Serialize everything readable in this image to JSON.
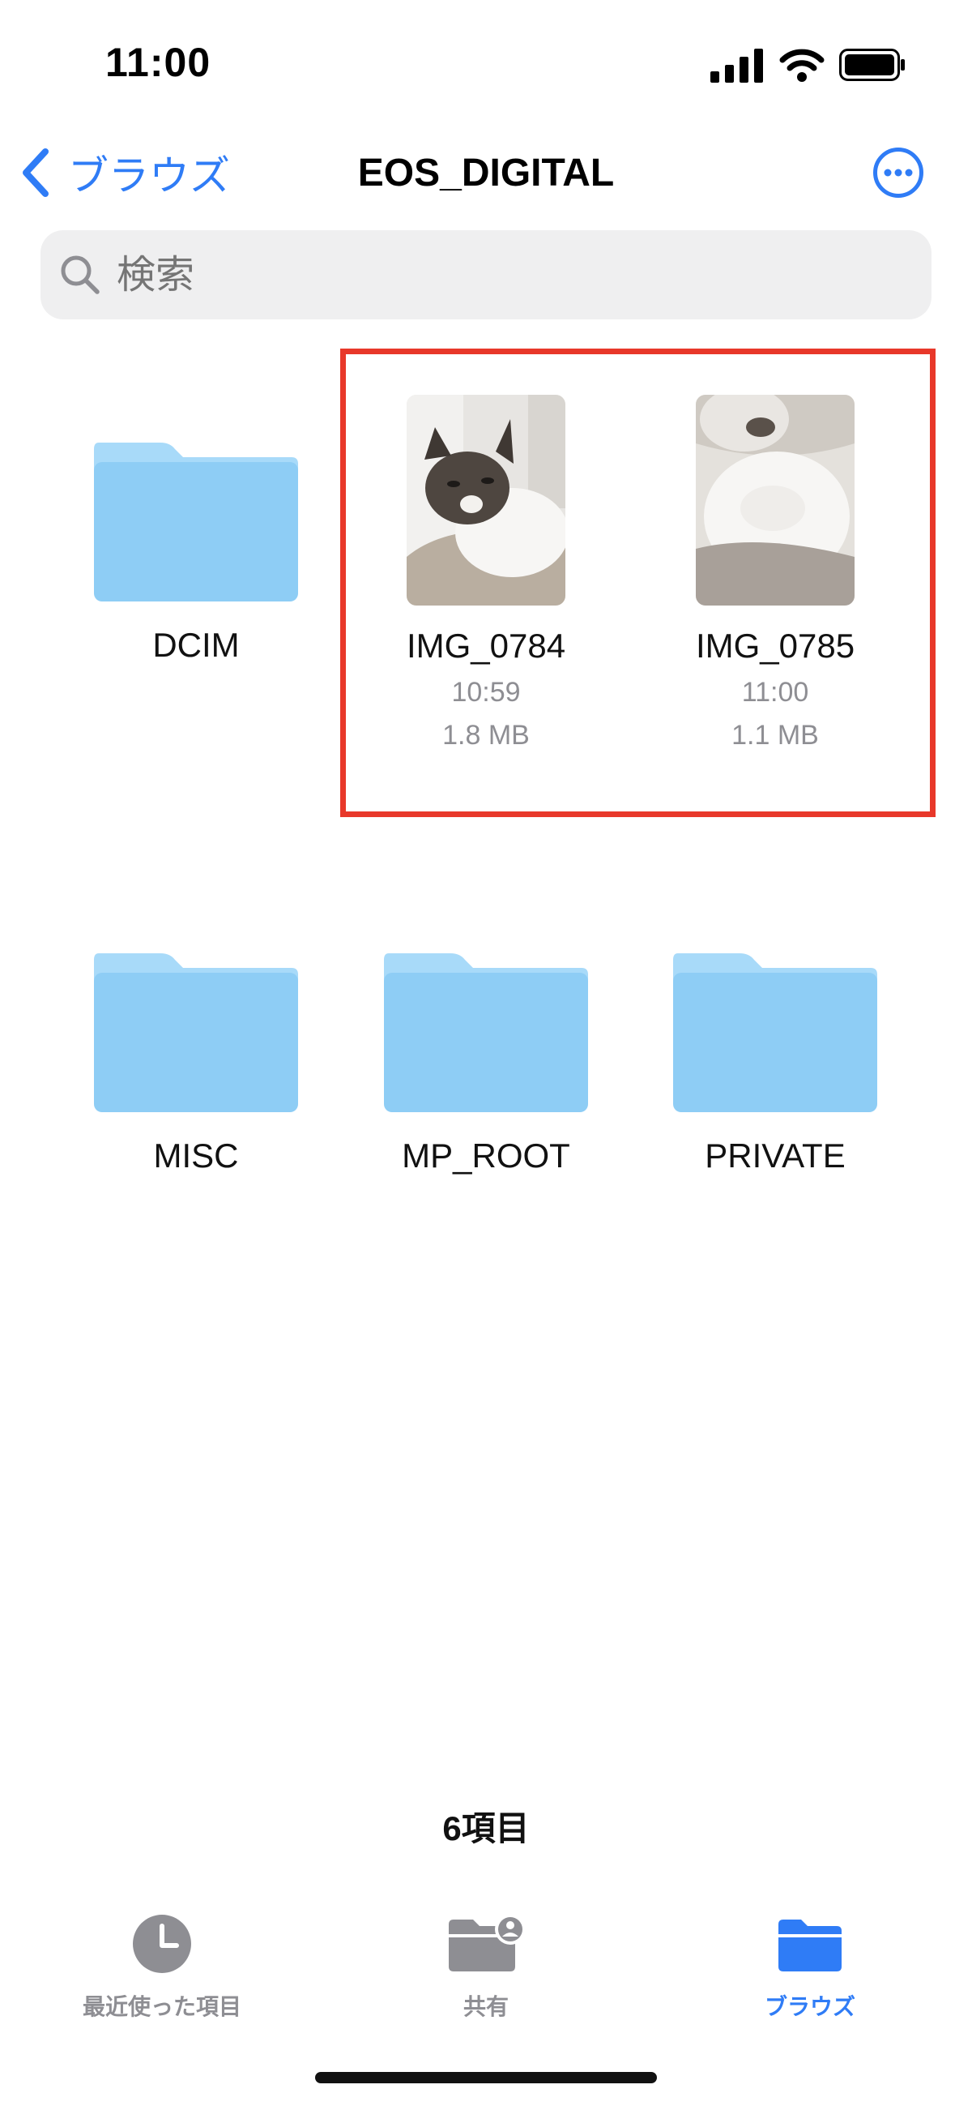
{
  "status_bar": {
    "time": "11:00"
  },
  "nav": {
    "back_label": "ブラウズ",
    "title": "EOS_DIGITAL"
  },
  "search": {
    "placeholder": "検索"
  },
  "items": [
    {
      "name": "DCIM",
      "kind": "folder"
    },
    {
      "name": "IMG_0784",
      "time": "10:59",
      "size": "1.8 MB",
      "kind": "image"
    },
    {
      "name": "IMG_0785",
      "time": "11:00",
      "size": "1.1 MB",
      "kind": "image"
    },
    {
      "name": "MISC",
      "kind": "folder"
    },
    {
      "name": "MP_ROOT",
      "kind": "folder"
    },
    {
      "name": "PRIVATE",
      "kind": "folder"
    }
  ],
  "footer": {
    "item_count": "6項目"
  },
  "tabs": [
    {
      "label": "最近使った項目",
      "icon": "clock-icon",
      "active": false
    },
    {
      "label": "共有",
      "icon": "shared-folder-icon",
      "active": false
    },
    {
      "label": "ブラウズ",
      "icon": "folder-icon",
      "active": true
    }
  ],
  "colors": {
    "accent": "#2f7cf6",
    "folder": "#8ecdf5",
    "highlight": "#e8382a",
    "inactive": "#8e8e93"
  }
}
